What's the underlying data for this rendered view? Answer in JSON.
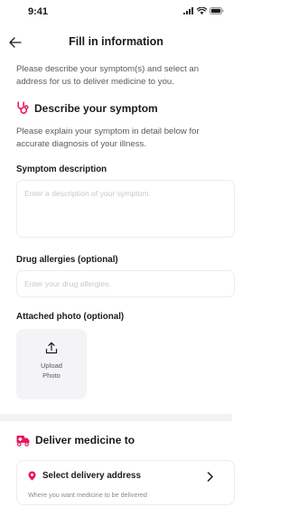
{
  "status_bar": {
    "time": "9:41"
  },
  "header": {
    "title": "Fill in information"
  },
  "intro": "Please describe your symptom(s) and select an address for us to deliver medicine to you.",
  "symptom_section": {
    "title": "Describe your symptom",
    "description": "Please explain your symptom in detail below for accurate diagnosis of your illness.",
    "symptom_label": "Symptom description",
    "symptom_placeholder": "Enter a description of your symptom.",
    "allergy_label": "Drug allergies (optional)",
    "allergy_placeholder": "Enter your drug allergies.",
    "photo_label": "Attached photo (optional)",
    "upload_label": "Upload Photo"
  },
  "delivery_section": {
    "title": "Deliver medicine to",
    "address_title": "Select delivery address",
    "address_subtitle": "Where you want medicine to be delivered"
  },
  "colors": {
    "accent": "#e8175d",
    "text": "#1b1b1f",
    "muted": "#5a5a60"
  },
  "icons": [
    "signal-icon",
    "wifi-icon",
    "battery-icon",
    "back-arrow-icon",
    "stethoscope-icon",
    "upload-icon",
    "delivery-truck-icon",
    "location-pin-icon",
    "chevron-right-icon"
  ]
}
